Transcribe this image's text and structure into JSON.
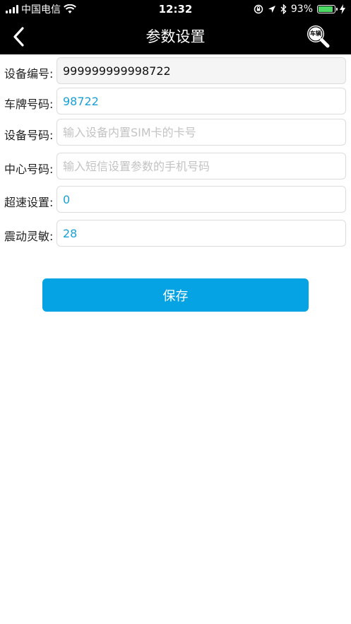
{
  "status_bar": {
    "carrier": "中国电信",
    "time": "12:32",
    "battery_percent": "93%",
    "battery_level": 0.93,
    "icons": [
      "signal-icon",
      "wifi-icon",
      "rotation-lock-icon",
      "location-icon",
      "bluetooth-icon",
      "battery-icon",
      "charging-icon"
    ]
  },
  "nav": {
    "title": "参数设置",
    "back_icon": "chevron-left-icon",
    "search_icon": "search-car-icon",
    "search_badge_text": "车辆"
  },
  "colors": {
    "header_bg": "#000000",
    "accent": "#05a3e3",
    "value_blue": "#1a9fd6",
    "placeholder": "#c3c3c3",
    "battery_green": "#4cd964"
  },
  "form": {
    "fields": [
      {
        "label": "设备编号:",
        "value": "999999999998722",
        "placeholder": ""
      },
      {
        "label": "车牌号码:",
        "value": "98722",
        "placeholder": ""
      },
      {
        "label": "设备号码:",
        "value": "",
        "placeholder": "输入设备内置SIM卡的卡号"
      },
      {
        "label": "中心号码:",
        "value": "",
        "placeholder": "输入短信设置参数的手机号码"
      },
      {
        "label": "超速设置:",
        "value": "0",
        "placeholder": ""
      },
      {
        "label": "震动灵敏:",
        "value": "28",
        "placeholder": ""
      }
    ]
  },
  "actions": {
    "save_label": "保存"
  }
}
